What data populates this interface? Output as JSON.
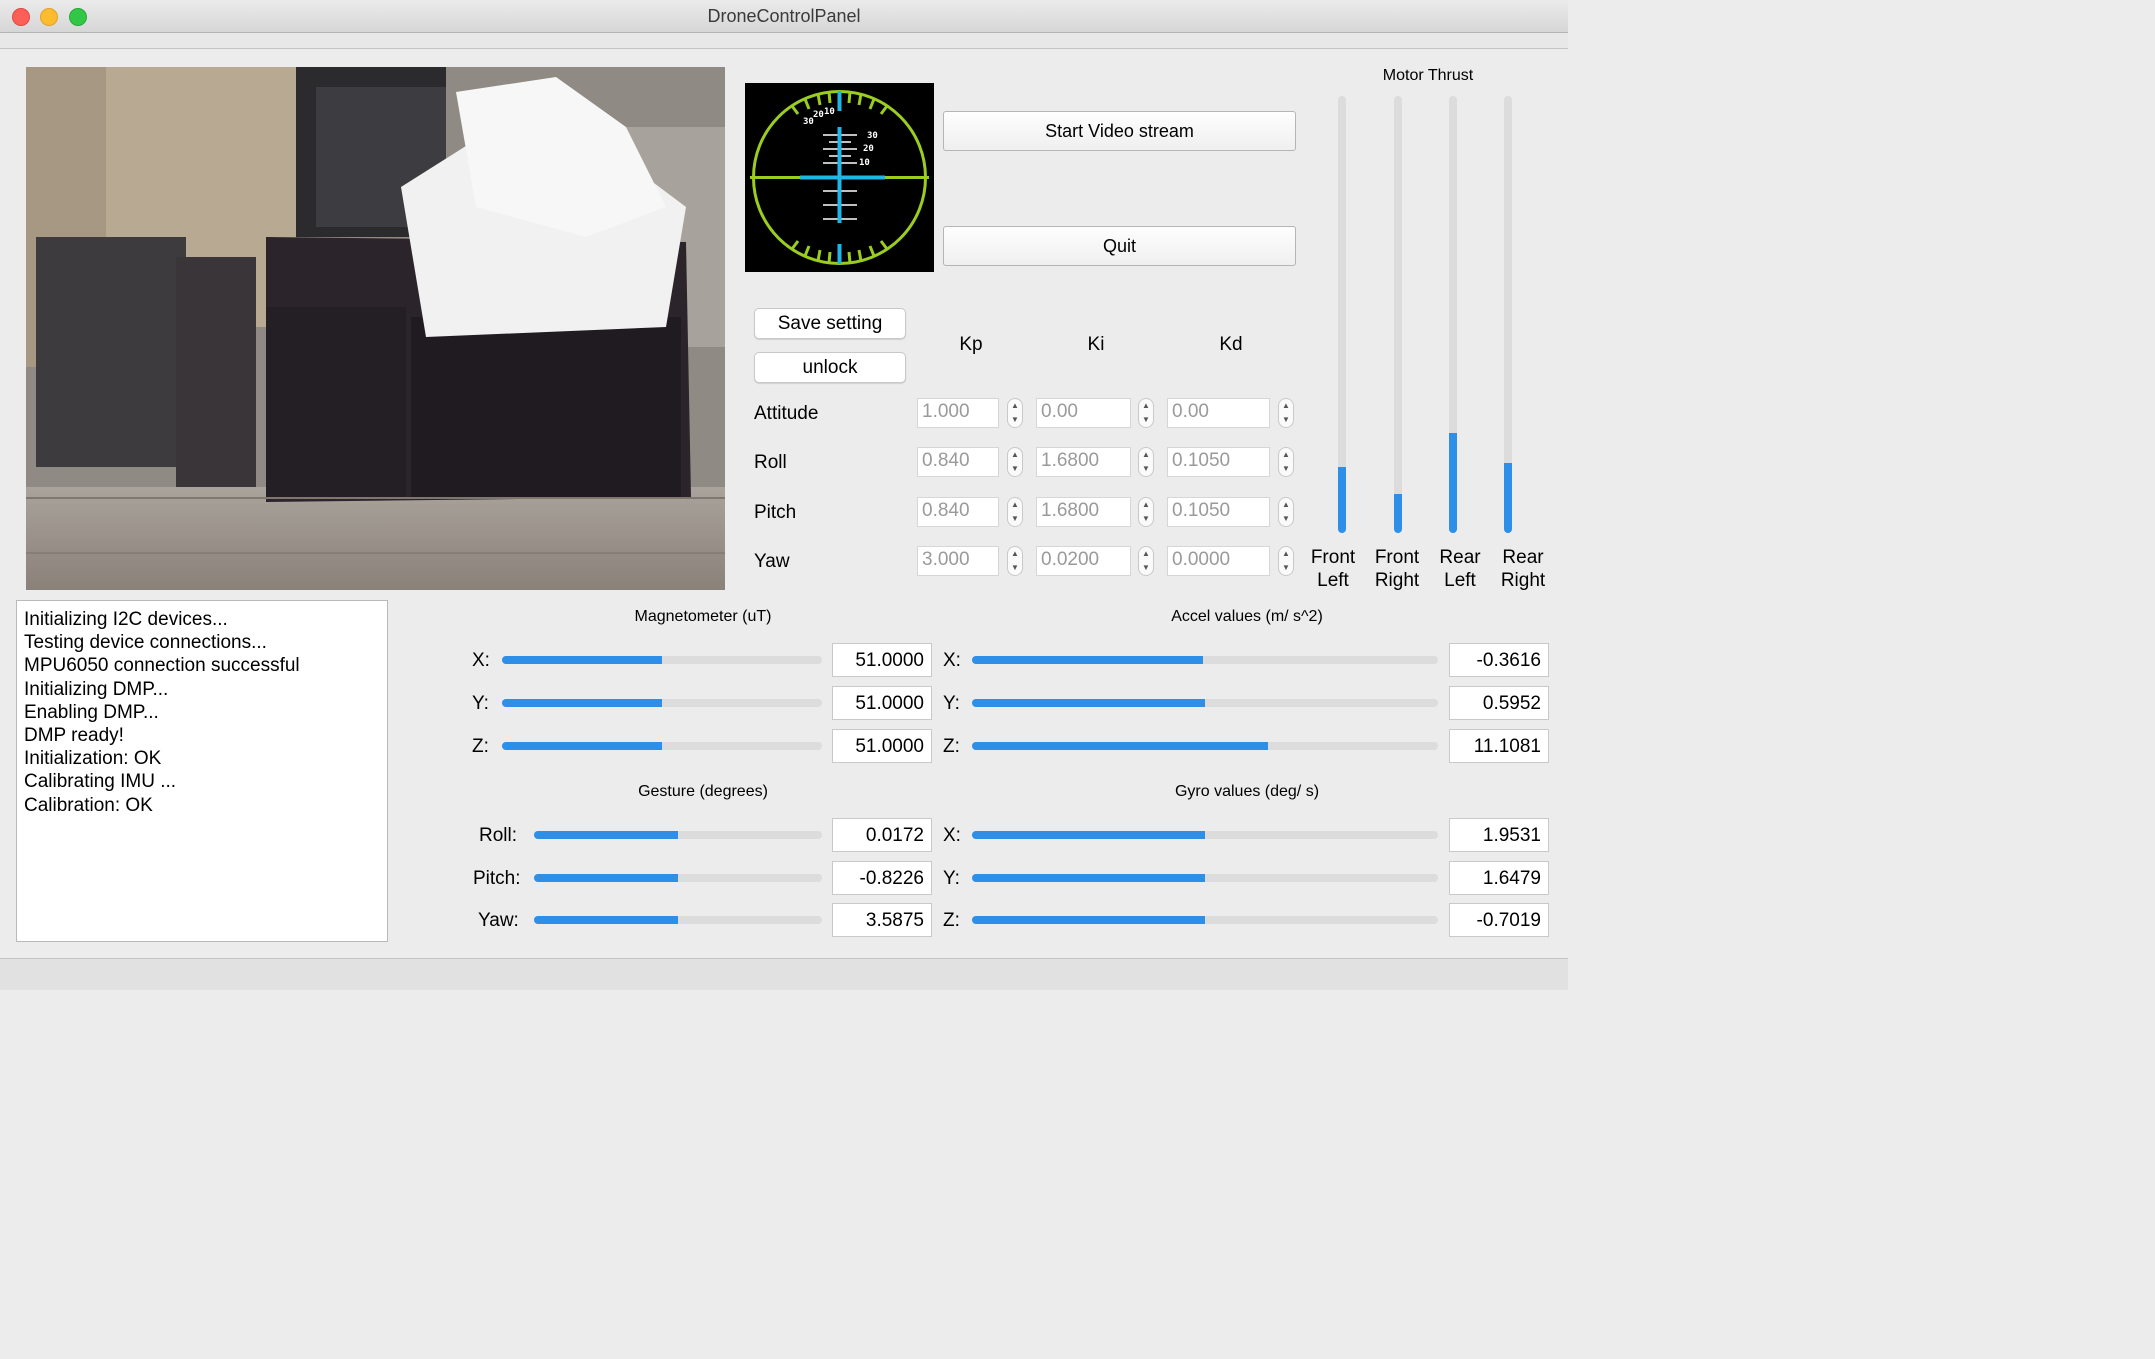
{
  "window": {
    "title": "DroneControlPanel"
  },
  "video": {
    "description": "camera-feed"
  },
  "console": {
    "lines": [
      "Initializing I2C devices...",
      "Testing device connections...",
      "MPU6050 connection successful",
      "Initializing DMP...",
      "Enabling DMP...",
      "DMP ready!",
      "Initialization: OK",
      "Calibrating IMU ...",
      "Calibration: OK"
    ]
  },
  "horizon": {
    "ticks_left": [
      "30",
      "20",
      "10"
    ],
    "ticks_right": [
      "30",
      "20",
      "10"
    ]
  },
  "buttons": {
    "start_video": "Start Video stream",
    "quit": "Quit",
    "save_setting": "Save setting",
    "unlock": "unlock"
  },
  "pid": {
    "headers": [
      "Kp",
      "Ki",
      "Kd"
    ],
    "rows": [
      {
        "label": "Attitude",
        "kp": "1.000",
        "ki": "0.00",
        "kd": "0.00"
      },
      {
        "label": "Roll",
        "kp": "0.840",
        "ki": "1.6800",
        "kd": "0.1050"
      },
      {
        "label": "Pitch",
        "kp": "0.840",
        "ki": "1.6800",
        "kd": "0.1050"
      },
      {
        "label": "Yaw",
        "kp": "3.000",
        "ki": "0.0200",
        "kd": "0.0000"
      }
    ]
  },
  "motor_thrust": {
    "title": "Motor Thrust",
    "motors": [
      {
        "line1": "Front",
        "line2": "Left",
        "level": 0.15
      },
      {
        "line1": "Front",
        "line2": "Right",
        "level": 0.09
      },
      {
        "line1": "Rear",
        "line2": "Left",
        "level": 0.23
      },
      {
        "line1": "Rear",
        "line2": "Right",
        "level": 0.16
      }
    ]
  },
  "magnetometer": {
    "title": "Magnetometer (uT)",
    "rows": [
      {
        "label": "X:",
        "value": "51.0000",
        "level": 0.5
      },
      {
        "label": "Y:",
        "value": "51.0000",
        "level": 0.5
      },
      {
        "label": "Z:",
        "value": "51.0000",
        "level": 0.5
      }
    ]
  },
  "accel": {
    "title": "Accel values (m/ s^2)",
    "rows": [
      {
        "label": "X:",
        "value": "-0.3616",
        "level": 0.495
      },
      {
        "label": "Y:",
        "value": "0.5952",
        "level": 0.5
      },
      {
        "label": "Z:",
        "value": "11.1081",
        "level": 0.635
      }
    ]
  },
  "gesture": {
    "title": "Gesture (degrees)",
    "rows": [
      {
        "label": "Roll:",
        "value": "0.0172",
        "level": 0.5
      },
      {
        "label": "Pitch:",
        "value": "-0.8226",
        "level": 0.5
      },
      {
        "label": "Yaw:",
        "value": "3.5875",
        "level": 0.5
      }
    ]
  },
  "gyro": {
    "title": "Gyro values (deg/ s)",
    "rows": [
      {
        "label": "X:",
        "value": "1.9531",
        "level": 0.5
      },
      {
        "label": "Y:",
        "value": "1.6479",
        "level": 0.5
      },
      {
        "label": "Z:",
        "value": "-0.7019",
        "level": 0.5
      }
    ]
  },
  "colors": {
    "accent": "#2d8fe8",
    "horizon_ring": "#9acd1e",
    "horizon_marker": "#1fb7e8"
  }
}
